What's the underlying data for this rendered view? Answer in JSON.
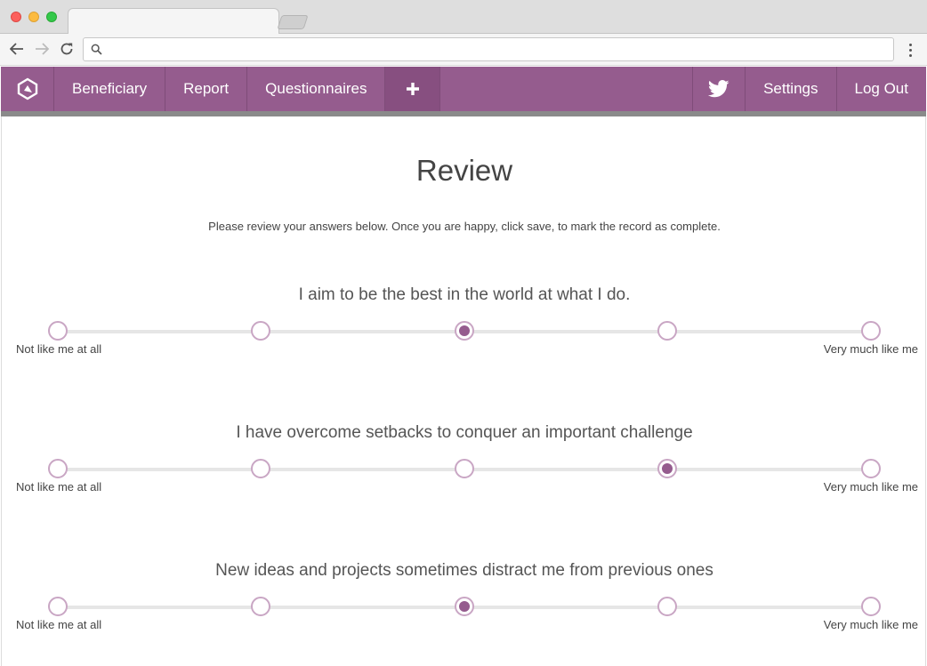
{
  "browser": {
    "tab_title": "",
    "address": ""
  },
  "nav": {
    "left_items": [
      "Beneficiary",
      "Report",
      "Questionnaires"
    ],
    "right_items": [
      "Settings",
      "Log Out"
    ]
  },
  "page": {
    "title": "Review",
    "instructions": "Please review your answers below. Once you are happy, click save, to mark the record as complete."
  },
  "scale": {
    "min_label": "Not like me at all",
    "max_label": "Very much like me",
    "points": 5
  },
  "questions": [
    {
      "text": "I aim to be the best in the world at what I do.",
      "selected": 3
    },
    {
      "text": "I have overcome setbacks to conquer an important challenge",
      "selected": 4
    },
    {
      "text": "New ideas and projects sometimes distract me from previous ones",
      "selected": 3
    }
  ],
  "colors": {
    "accent": "#955c8e",
    "ring": "#c9a6c4"
  }
}
